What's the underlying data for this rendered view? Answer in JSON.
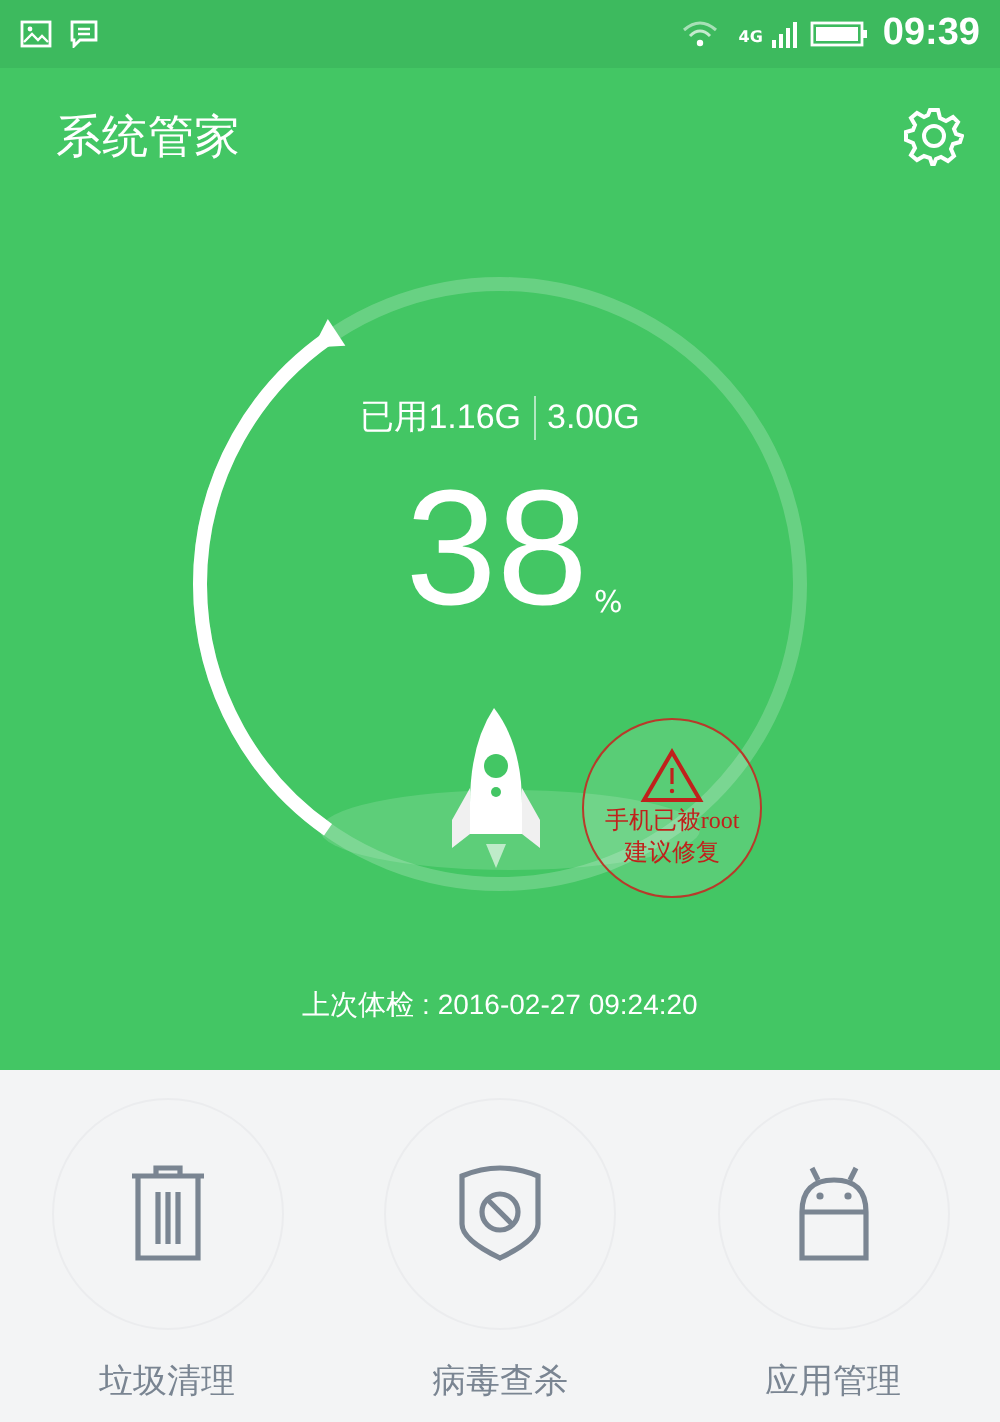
{
  "status_bar": {
    "network": "4G",
    "time": "09:39"
  },
  "header": {
    "title": "系统管家"
  },
  "memory": {
    "used": "已用1.16G",
    "total": "3.00G",
    "percent": "38",
    "unit": "%"
  },
  "warning": {
    "lines": [
      "手机已被root",
      "建议修复"
    ]
  },
  "last_check": "上次体检 : 2016-02-27 09:24:20",
  "tools": [
    {
      "label": "垃圾清理",
      "kind": "trash"
    },
    {
      "label": "病毒查杀",
      "kind": "shield"
    },
    {
      "label": "应用管理",
      "kind": "android"
    }
  ]
}
